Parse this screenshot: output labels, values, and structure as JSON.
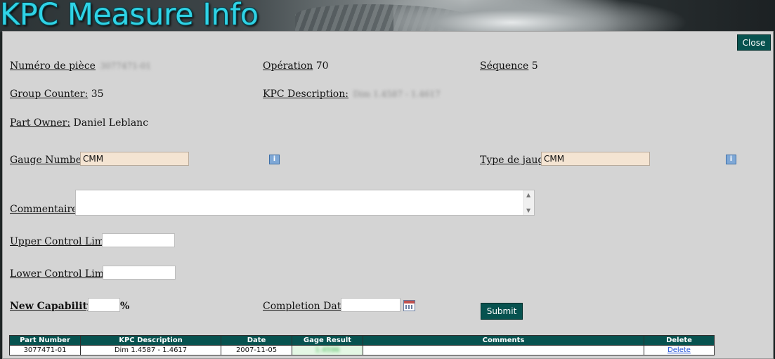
{
  "header": {
    "title": "KPC Measure Info"
  },
  "dialog": {
    "close_label": "Close"
  },
  "fields": {
    "part_number": {
      "label": "Numéro de pièce",
      "value": "3077471-01"
    },
    "operation": {
      "label": "Opération",
      "value": "70"
    },
    "sequence": {
      "label": "Séquence",
      "value": "5"
    },
    "group_counter": {
      "label": "Group Counter:",
      "value": "35"
    },
    "kpc_description": {
      "label": "KPC Description:",
      "value": "Dim 1.4587 - 1.4617"
    },
    "part_owner": {
      "label": "Part Owner:",
      "value": "Daniel Leblanc"
    },
    "gauge_number": {
      "label": "Gauge Number:",
      "value": "CMM"
    },
    "gauge_type": {
      "label": "Type de jauge",
      "value": "CMM"
    },
    "comments": {
      "label": "Commentaires",
      "value": ""
    },
    "upper_control_limit": {
      "label": "Upper Control Limit:",
      "value": ""
    },
    "lower_control_limit": {
      "label": "Lower Control Limit:",
      "value": ""
    },
    "new_capability": {
      "label": "New Capability:",
      "value": "",
      "suffix": "%"
    },
    "completion_date": {
      "label": "Completion Date:",
      "value": ""
    }
  },
  "submit_label": "Submit",
  "icons": {
    "info": "info-icon",
    "calendar": "calendar-icon"
  },
  "colors": {
    "accent": "#07524f",
    "title": "#2fd3e6",
    "gauge_bg": "#f4e4d2",
    "background": "#d4d4d4"
  },
  "table": {
    "columns": [
      "Part Number",
      "KPC Description",
      "Date",
      "Gage Result",
      "Comments",
      "Delete"
    ],
    "rows": [
      {
        "part_number": "3077471-01",
        "kpc_description": "Dim 1.4587 - 1.4617",
        "date": "2007-11-05",
        "gage_result": "1.4596",
        "comments": "",
        "delete": "Delete"
      }
    ]
  }
}
